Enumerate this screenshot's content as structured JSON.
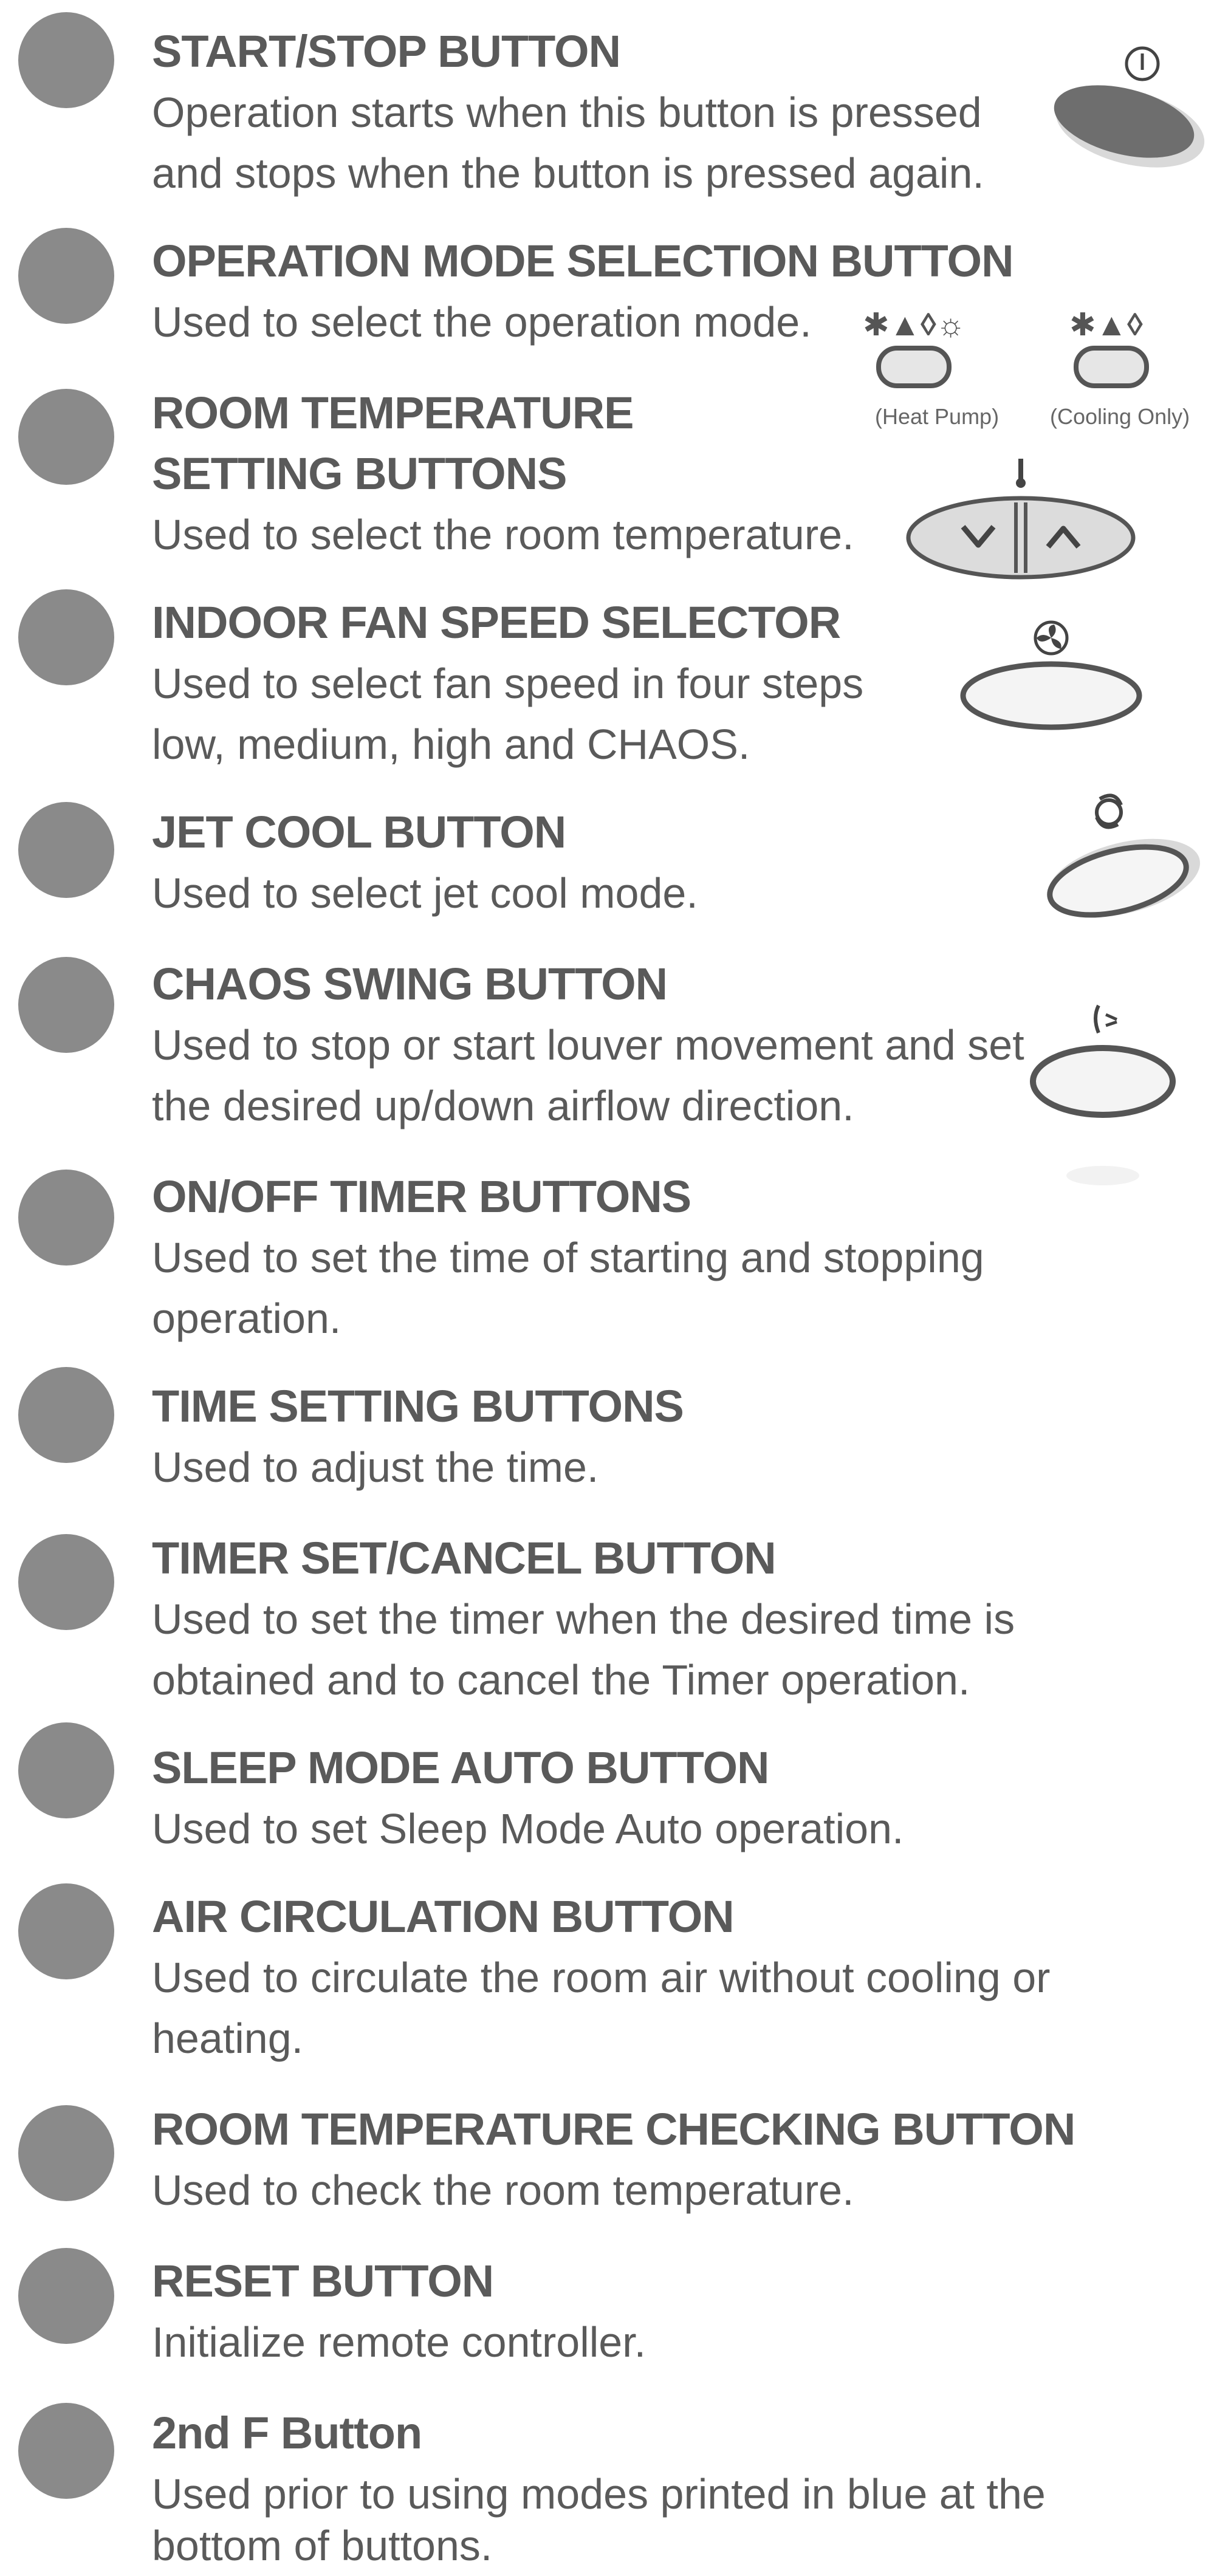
{
  "items": [
    {
      "title": "START/STOP BUTTON",
      "desc": [
        "Operation starts when this button is pressed",
        "and stops when the button is pressed again."
      ]
    },
    {
      "title": "OPERATION MODE SELECTION BUTTON",
      "desc": [
        "Used to select the operation mode."
      ]
    },
    {
      "title": "ROOM TEMPERATURE",
      "title2": "SETTING BUTTONS",
      "desc": [
        "Used to select the room temperature."
      ]
    },
    {
      "title": "INDOOR FAN SPEED SELECTOR",
      "desc": [
        "Used to select fan speed in four steps",
        "low, medium, high and CHAOS."
      ]
    },
    {
      "title": "JET COOL BUTTON",
      "desc": [
        "Used to select jet cool mode."
      ]
    },
    {
      "title": "CHAOS SWING BUTTON",
      "desc": [
        "Used to stop or start louver movement and set",
        "the desired up/down airflow direction."
      ]
    },
    {
      "title": "ON/OFF TIMER BUTTONS",
      "desc": [
        "Used to set the time of starting and stopping",
        "operation."
      ]
    },
    {
      "title": "TIME SETTING BUTTONS",
      "desc": [
        "Used to adjust the time."
      ]
    },
    {
      "title": "TIMER SET/CANCEL BUTTON",
      "desc": [
        "Used to set the timer when the desired time is",
        "obtained and to cancel the Timer operation."
      ]
    },
    {
      "title": "SLEEP MODE AUTO BUTTON",
      "desc": [
        "Used to set Sleep Mode Auto operation."
      ]
    },
    {
      "title": "AIR CIRCULATION BUTTON",
      "desc": [
        "Used to circulate the room air without cooling or",
        "heating."
      ]
    },
    {
      "title": "ROOM TEMPERATURE CHECKING BUTTON",
      "desc": [
        "Used to check the room temperature."
      ]
    },
    {
      "title": "RESET BUTTON",
      "desc": [
        "Initialize remote controller."
      ]
    },
    {
      "title": "2nd F Button",
      "desc": [
        "Used prior to using modes printed in blue at the",
        "bottom of buttons."
      ]
    }
  ],
  "icons": {
    "heat_pump_symbols": "✱▲◊☼",
    "heat_pump_caption": "(Heat Pump)",
    "cooling_only_symbols": "✱▲◊",
    "cooling_only_caption": "(Cooling Only)",
    "start_stop_icon": "power-icon",
    "fan_icon": "fan-icon",
    "jet_icon": "jet-cool-icon",
    "swing_icon": "swing-icon"
  },
  "colors": {
    "bullet": "#8a8a8a",
    "text": "#5a5a5a"
  }
}
